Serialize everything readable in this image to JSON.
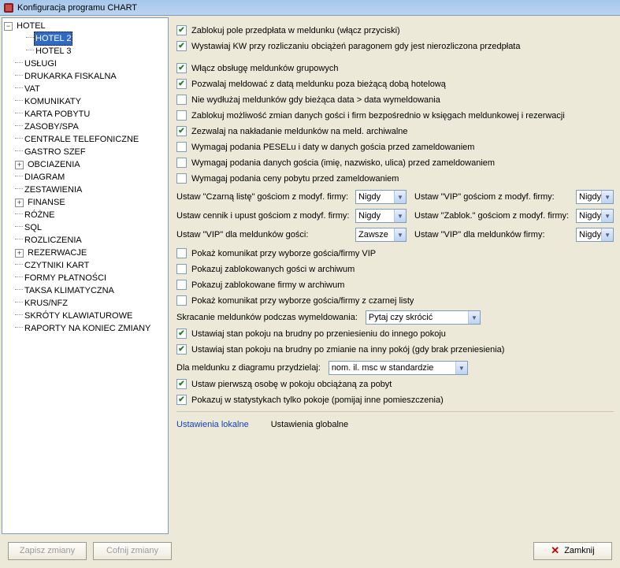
{
  "window": {
    "title": "Konfiguracja programu CHART"
  },
  "tree": {
    "root": {
      "label": "HOTEL",
      "expanded": true
    },
    "child_selected": {
      "label": "HOTEL 2"
    },
    "child_other": {
      "label": "HOTEL 3"
    },
    "items": [
      "USŁUGI",
      "DRUKARKA FISKALNA",
      "VAT",
      "KOMUNIKATY",
      "KARTA POBYTU",
      "ZASOBY/SPA",
      "CENTRALE TELEFONICZNE",
      "GASTRO SZEF",
      "OBCIAZENIA",
      "DIAGRAM",
      "ZESTAWIENIA",
      "FINANSE",
      "RÓŻNE",
      "SQL",
      "ROZLICZENIA",
      "REZERWACJE",
      "CZYTNIKI KART",
      "FORMY PŁATNOŚCI",
      "TAKSA KLIMATYCZNA",
      "KRUS/NFZ",
      "SKRÓTY KLAWIATUROWE",
      "RAPORTY NA KONIEC ZMIANY"
    ],
    "expanders": {
      "OBCIAZENIA": true,
      "FINANSE": true,
      "REZERWACJE": true
    }
  },
  "groupA": [
    {
      "checked": true,
      "label": "Zablokuj pole przedpłata w meldunku (włącz przyciski)"
    },
    {
      "checked": true,
      "label": "Wystawiaj KW przy rozliczaniu obciążeń paragonem gdy jest nierozliczona przedpłata"
    }
  ],
  "groupB": [
    {
      "checked": true,
      "label": "Włącz obsługę meldunków grupowych"
    },
    {
      "checked": true,
      "label": "Pozwalaj meldować z datą meldunku poza bieżącą dobą hotelową"
    },
    {
      "checked": false,
      "label": "Nie wydłużaj meldunków gdy bieżąca data > data wymeldowania"
    },
    {
      "checked": false,
      "label": "Zablokuj możliwość zmian danych gości i firm bezpośrednio w księgach meldunkowej i rezerwacji"
    },
    {
      "checked": true,
      "label": "Zezwalaj na nakładanie meldunków na meld. archiwalne"
    },
    {
      "checked": false,
      "label": "Wymagaj podania PESELu i daty w danych gościa przed zameldowaniem"
    },
    {
      "checked": false,
      "label": "Wymagaj podania danych gościa (imię, nazwisko, ulica) przed zameldowaniem"
    },
    {
      "checked": false,
      "label": "Wymagaj podania ceny pobytu przed zameldowaniem"
    }
  ],
  "grid": {
    "r1l": "Ustaw \"Czarną listę\" gościom z modyf. firmy:",
    "r1v": "Nigdy",
    "r1r": "Ustaw \"VIP\" gościom z modyf. firmy:",
    "r1rv": "Nigdy",
    "r2l": "Ustaw cennik i upust gościom z modyf. firmy:",
    "r2v": "Nigdy",
    "r2r": "Ustaw \"Zablok.\" gościom z modyf. firmy:",
    "r2rv": "Nigdy",
    "r3l": "Ustaw \"VIP\" dla meldunków gości:",
    "r3v": "Zawsze",
    "r3r": "Ustaw \"VIP\" dla meldunków firmy:",
    "r3rv": "Nigdy"
  },
  "groupC": [
    {
      "checked": false,
      "label": "Pokaż komunikat przy wyborze gościa/firmy VIP"
    },
    {
      "checked": false,
      "label": "Pokazuj zablokowanych gości w archiwum"
    },
    {
      "checked": false,
      "label": "Pokazuj zablokowane firmy w archiwum"
    },
    {
      "checked": false,
      "label": "Pokaż komunikat przy wyborze gościa/firmy z czarnej listy"
    }
  ],
  "shorten": {
    "label": "Skracanie meldunków podczas wymeldowania:",
    "value": "Pytaj czy skrócić"
  },
  "groupD": [
    {
      "checked": true,
      "label": "Ustawiaj stan pokoju na brudny po przeniesieniu do innego pokoju"
    },
    {
      "checked": true,
      "label": "Ustawiaj stan pokoju na brudny po zmianie na inny pokój (gdy brak przeniesienia)"
    }
  ],
  "assign": {
    "label": "Dla meldunku z diagramu przydzielaj:",
    "value": "nom. il. msc w standardzie"
  },
  "groupE": [
    {
      "checked": true,
      "label": "Ustaw pierwszą osobę w pokoju obciążaną za pobyt"
    },
    {
      "checked": true,
      "label": "Pokazuj w statystykach  tylko pokoje (pomijaj inne pomieszczenia)"
    }
  ],
  "tabs": {
    "local": "Ustawienia lokalne",
    "global": "Ustawienia globalne"
  },
  "buttons": {
    "save": "Zapisz zmiany",
    "undo": "Cofnij zmiany",
    "close": "Zamknij"
  }
}
